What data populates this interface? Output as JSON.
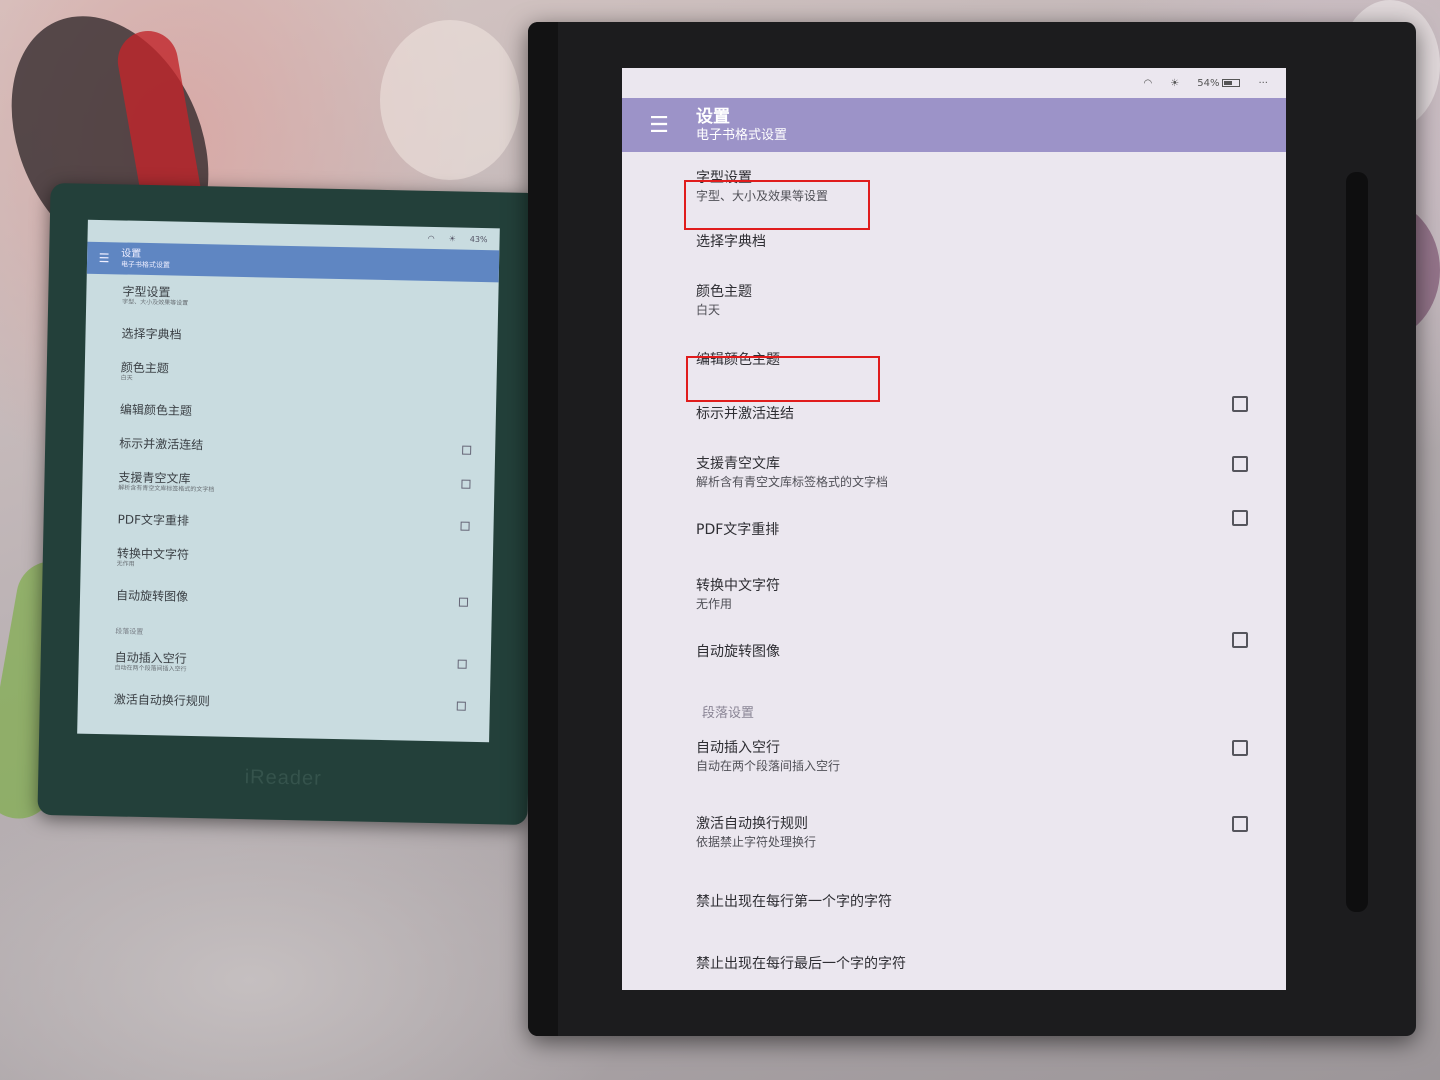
{
  "small_reader": {
    "brand": "iReader",
    "status": {
      "battery": "43%"
    },
    "appbar": {
      "title": "设置",
      "subtitle": "电子书格式设置"
    },
    "items": [
      {
        "label": "字型设置",
        "sub": "字型、大小及效果等设置"
      },
      {
        "label": "选择字典档"
      },
      {
        "label": "颜色主题",
        "sub": "白天"
      },
      {
        "label": "编辑颜色主题"
      },
      {
        "label": "标示并激活连结",
        "checked": false
      },
      {
        "label": "支援青空文库",
        "sub": "解析含有青空文库标签格式的文字档",
        "checked": false
      },
      {
        "label": "PDF文字重排",
        "checked": false
      },
      {
        "label": "转换中文字符",
        "sub": "无作用"
      },
      {
        "label": "自动旋转图像",
        "checked": false
      }
    ],
    "section": "段落设置",
    "items2": [
      {
        "label": "自动插入空行",
        "sub": "自动在两个段落间插入空行",
        "checked": false
      },
      {
        "label": "激活自动换行规则",
        "checked": false
      }
    ]
  },
  "large_reader": {
    "status": {
      "battery": "54%",
      "more": "···"
    },
    "appbar": {
      "title": "设置",
      "subtitle": "电子书格式设置"
    },
    "items": [
      {
        "label": "字型设置",
        "sub": "字型、大小及效果等设置"
      },
      {
        "label": "选择字典档"
      },
      {
        "label": "颜色主题",
        "sub": "白天"
      },
      {
        "label": "编辑颜色主题"
      },
      {
        "label": "标示并激活连结",
        "checked": false
      },
      {
        "label": "支援青空文库",
        "sub": "解析含有青空文库标签格式的文字档",
        "checked": false
      },
      {
        "label": "PDF文字重排",
        "checked": false
      },
      {
        "label": "转换中文字符",
        "sub": "无作用"
      },
      {
        "label": "自动旋转图像",
        "checked": false
      }
    ],
    "section": "段落设置",
    "items2": [
      {
        "label": "自动插入空行",
        "sub": "自动在两个段落间插入空行",
        "checked": false
      },
      {
        "label": "激活自动换行规则",
        "sub": "依据禁止字符处理换行",
        "checked": false
      },
      {
        "label": "禁止出现在每行第一个字的字符"
      },
      {
        "label": "禁止出现在每行最后一个字的字符"
      }
    ]
  },
  "annotations": {
    "highlight_color": "#e01c1c"
  },
  "colors": {
    "small_appbar": "#5f86c2",
    "large_appbar": "#9c93c8"
  }
}
